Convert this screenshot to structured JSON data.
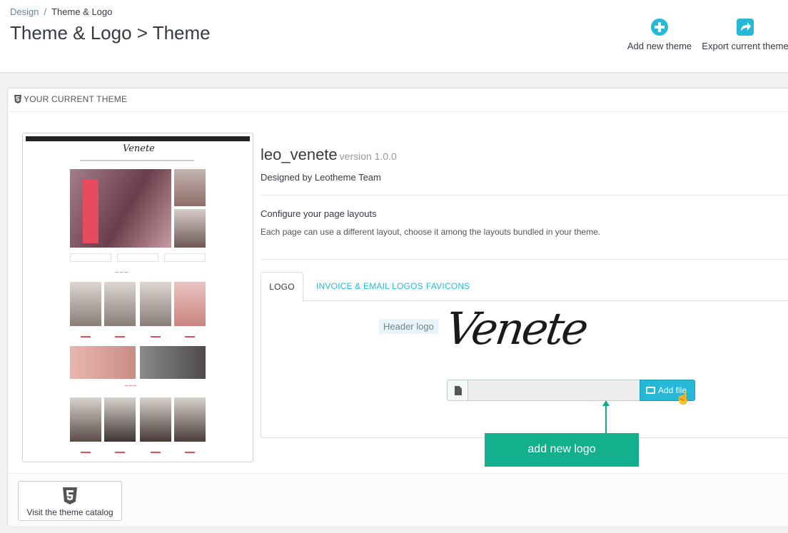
{
  "breadcrumb": {
    "parent": "Design",
    "separator": "/",
    "current": "Theme & Logo"
  },
  "page_title": "Theme & Logo > Theme",
  "toolbar": {
    "add_label": "Add new theme",
    "export_label": "Export current theme"
  },
  "panel": {
    "heading": "YOUR CURRENT THEME"
  },
  "theme": {
    "name": "leo_venete",
    "version": "version 1.0.0",
    "author": "Designed by Leotheme Team",
    "preview_logo": "Venete"
  },
  "layouts": {
    "title": "Configure your page layouts",
    "description": "Each page can use a different layout, choose it among the layouts bundled in your theme."
  },
  "tabs": [
    {
      "label": "LOGO"
    },
    {
      "label": "INVOICE & EMAIL LOGOS"
    },
    {
      "label": "FAVICONS"
    }
  ],
  "logo_tab": {
    "header_logo_label": "Header logo",
    "logo_text": "Venete",
    "add_file_label": "Add file"
  },
  "annotation": "add new logo",
  "footer": {
    "catalog_label": "Visit the theme catalog"
  },
  "colors": {
    "accent": "#25b9d7",
    "annotation": "#14b08d",
    "brand_red": "#e84a5f"
  }
}
